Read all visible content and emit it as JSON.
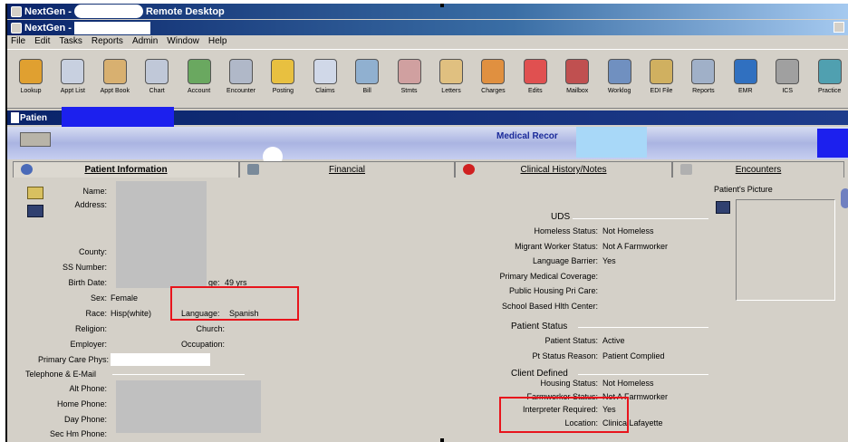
{
  "window": {
    "title_prefix": "NextGen -",
    "title_suffix": "Remote Desktop",
    "inner_title": "NextGen -"
  },
  "menu": [
    "File",
    "Edit",
    "Tasks",
    "Reports",
    "Admin",
    "Window",
    "Help"
  ],
  "toolbar": [
    {
      "label": "Lookup",
      "icon": "lookup-icon",
      "color": "#e0a030"
    },
    {
      "label": "Appt List",
      "icon": "appt-list-icon",
      "color": "#c8d0e0"
    },
    {
      "label": "Appt Book",
      "icon": "appt-book-icon",
      "color": "#d8b070"
    },
    {
      "label": "Chart",
      "icon": "chart-icon",
      "color": "#c0c8d8"
    },
    {
      "label": "Account",
      "icon": "account-icon",
      "color": "#6aa860"
    },
    {
      "label": "Encounter",
      "icon": "encounter-icon",
      "color": "#b0b8c8"
    },
    {
      "label": "Posting",
      "icon": "posting-icon",
      "color": "#e8c040"
    },
    {
      "label": "Claims",
      "icon": "claims-icon",
      "color": "#d0d8e8"
    },
    {
      "label": "Bill",
      "icon": "bill-icon",
      "color": "#90b0d0"
    },
    {
      "label": "Stmts",
      "icon": "stmts-icon",
      "color": "#d0a0a0"
    },
    {
      "label": "Letters",
      "icon": "letters-icon",
      "color": "#e0c080"
    },
    {
      "label": "Charges",
      "icon": "charges-icon",
      "color": "#e09040"
    },
    {
      "label": "Edits",
      "icon": "edits-icon",
      "color": "#e05050"
    },
    {
      "label": "Mailbox",
      "icon": "mailbox-icon",
      "color": "#c05050"
    },
    {
      "label": "Worklog",
      "icon": "worklog-icon",
      "color": "#7090c0"
    },
    {
      "label": "EDI File",
      "icon": "edi-file-icon",
      "color": "#d0b060"
    },
    {
      "label": "Reports",
      "icon": "reports-icon",
      "color": "#a0b0c8"
    },
    {
      "label": "EMR",
      "icon": "emr-icon",
      "color": "#3070c0"
    },
    {
      "label": "ICS",
      "icon": "ics-icon",
      "color": "#a0a0a0"
    },
    {
      "label": "Practice",
      "icon": "practice-icon",
      "color": "#50a0b0"
    }
  ],
  "patient_bar": {
    "label": "Patien"
  },
  "banner": {
    "title": "Medical Recor"
  },
  "tabs": [
    {
      "label": "Patient Information",
      "icon": "patient-info-tab-icon"
    },
    {
      "label": "Financial",
      "icon": "financial-tab-icon"
    },
    {
      "label": "Clinical History/Notes",
      "icon": "clinical-history-tab-icon"
    },
    {
      "label": "Encounters",
      "icon": "encounters-tab-icon"
    }
  ],
  "left_labels": {
    "name": "Name:",
    "address": "Address:",
    "county": "County:",
    "ssn": "SS Number:",
    "birth_date": "Birth Date:",
    "sex": "Sex:",
    "race": "Race:",
    "religion": "Religion:",
    "employer": "Employer:",
    "primary_care": "Primary Care Phys:",
    "telephone_header": "Telephone & E-Mail",
    "alt_phone": "Alt Phone:",
    "home_phone": "Home Phone:",
    "day_phone": "Day Phone:",
    "sec_hm_phone": "Sec Hm Phone:"
  },
  "left_values": {
    "age_label": "ge:",
    "age": "49 yrs",
    "sex": "Female",
    "race": "Hisp(white)",
    "language_label": "Language:",
    "language": "Spanish",
    "church_label": "Church:",
    "occupation_label": "Occupation:"
  },
  "uds": {
    "header": "UDS",
    "rows": [
      {
        "label": "Homeless Status:",
        "value": "Not Homeless"
      },
      {
        "label": "Migrant Worker Status:",
        "value": "Not A Farmworker"
      },
      {
        "label": "Language Barrier:",
        "value": "Yes"
      },
      {
        "label": "Primary Medical Coverage:",
        "value": ""
      },
      {
        "label": "Public Housing Pri Care:",
        "value": ""
      },
      {
        "label": "School Based Hlth Center:",
        "value": ""
      }
    ]
  },
  "patient_status": {
    "header": "Patient Status",
    "rows": [
      {
        "label": "Patient Status:",
        "value": "Active"
      },
      {
        "label": "Pt Status Reason:",
        "value": "Patient Complied"
      }
    ]
  },
  "client_defined": {
    "header": "Client Defined",
    "rows": [
      {
        "label": "Housing Status:",
        "value": "Not Homeless"
      },
      {
        "label": "Farmworker Status:",
        "value": "Not A Farmworker"
      },
      {
        "label": "Interpreter Required:",
        "value": "Yes"
      },
      {
        "label": "Location:",
        "value": "Clinica Lafayette"
      }
    ]
  },
  "picture": {
    "label": "Patient's Picture"
  }
}
